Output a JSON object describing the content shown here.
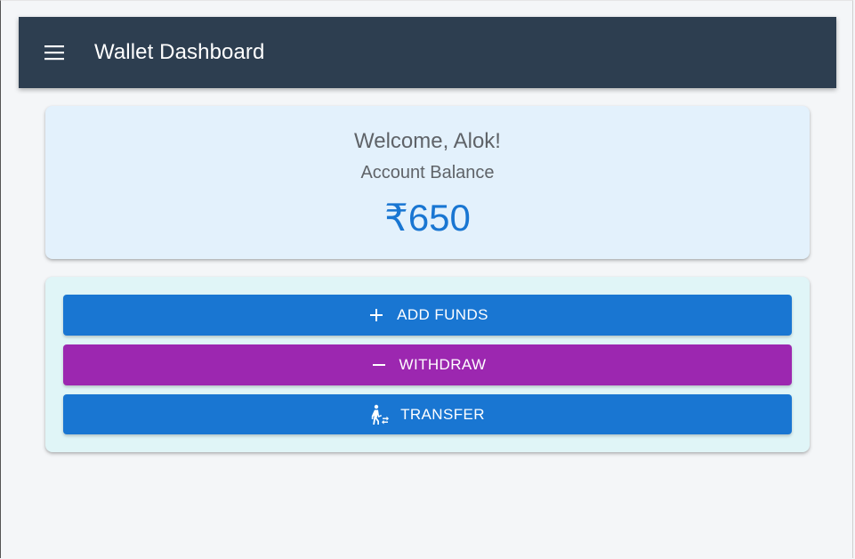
{
  "header": {
    "title": "Wallet Dashboard",
    "menu_icon": "menu-icon"
  },
  "balance_card": {
    "welcome": "Welcome, Alok!",
    "label": "Account Balance",
    "amount": "₹650"
  },
  "actions": {
    "add_funds": {
      "label": "ADD FUNDS",
      "icon": "plus-icon"
    },
    "withdraw": {
      "label": "WITHDRAW",
      "icon": "minus-icon"
    },
    "transfer": {
      "label": "TRANSFER",
      "icon": "transfer-person-icon"
    }
  },
  "colors": {
    "appbar": "#2d3e50",
    "primary": "#1976d2",
    "secondary": "#9c27b0",
    "balance_card_bg": "#e3f1fc",
    "actions_card_bg": "#e0f5f7"
  }
}
